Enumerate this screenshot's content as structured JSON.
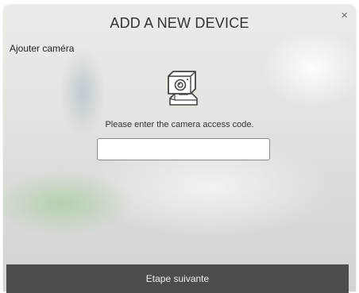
{
  "dialog": {
    "title": "ADD A NEW DEVICE",
    "close_glyph": "×",
    "subtitle": "Ajouter caméra",
    "device_icon": "camera-icon",
    "prompt": "Please enter the camera access code.",
    "access_code_value": "",
    "access_code_placeholder": "",
    "next_button_label": "Etape suivante"
  },
  "colors": {
    "button_bg": "#4d4c4a",
    "button_text": "#eeeeee",
    "title_text": "#333333"
  }
}
